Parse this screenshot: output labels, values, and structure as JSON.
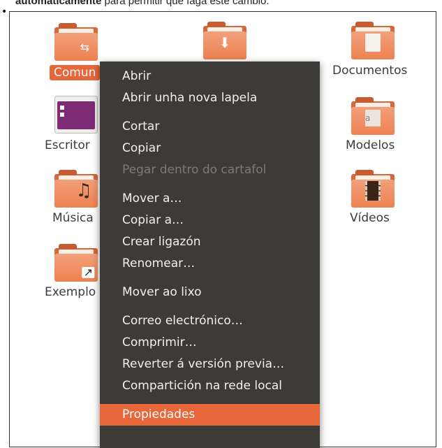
{
  "instruction": {
    "bold": "automaticamente",
    "rest": " para permitir que faga este cambio."
  },
  "desktop": {
    "icons": [
      {
        "label": "Comun",
        "emblem": "share-icon",
        "selected": true
      },
      {
        "label": "",
        "emblem": "download-icon"
      },
      {
        "label": "Documentos",
        "emblem": "document-icon"
      },
      {
        "label": "Escritor",
        "emblem": "desktop-icon"
      },
      {
        "label": "Modelos",
        "emblem": "template-icon"
      },
      {
        "label": "Música",
        "emblem": "music-icon"
      },
      {
        "label": "Vídeos",
        "emblem": "film-icon"
      },
      {
        "label": "Exemplo",
        "emblem": "link-arrow-icon"
      }
    ]
  },
  "context_menu": {
    "groups": [
      [
        "Abrir",
        "Abrir unha nova lapela"
      ],
      [
        "Cortar",
        "Copiar",
        "Pegar dentro do cartafol"
      ],
      [
        "Mover a…",
        "Copiar a…",
        "Crear ligazón",
        "Renomear…"
      ],
      [
        "Mover ao lixo"
      ],
      [
        "Correo electrónico…",
        "Comprimir…",
        "Reverter á versión previa…",
        "Compartición na rede local"
      ],
      [
        "Propiedades"
      ]
    ],
    "disabled_item": "Pegar dentro do cartafol",
    "highlighted_item": "Propiedades"
  },
  "colors": {
    "accent": "#e8673a",
    "menu_bg": "#3d3b37",
    "menu_text": "#f2f1ef",
    "disabled_text": "#7c7a75"
  }
}
